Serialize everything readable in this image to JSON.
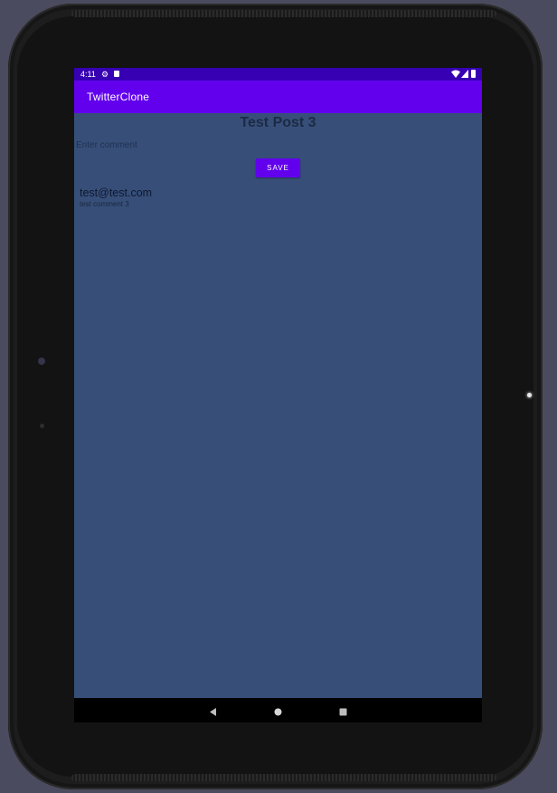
{
  "status_bar": {
    "time": "4:11",
    "icons": [
      "gear-icon",
      "sd-card-icon",
      "wifi-icon",
      "signal-icon",
      "battery-icon"
    ]
  },
  "app_bar": {
    "title": "TwitterClone"
  },
  "post": {
    "title": "Test Post 3"
  },
  "comment_form": {
    "placeholder": "Enter comment",
    "save_label": "SAVE"
  },
  "comments": [
    {
      "author": "test@test.com",
      "text": "test comment 3"
    }
  ],
  "nav_bar": {
    "icons": [
      "back-icon",
      "home-icon",
      "recents-icon"
    ]
  },
  "colors": {
    "status_bar": "#3700b3",
    "app_bar": "#6200ee",
    "screen_background": "#374f78",
    "button": "#6200ee",
    "device_frame": "#1d1d1d",
    "backdrop": "#4a4b5e"
  }
}
